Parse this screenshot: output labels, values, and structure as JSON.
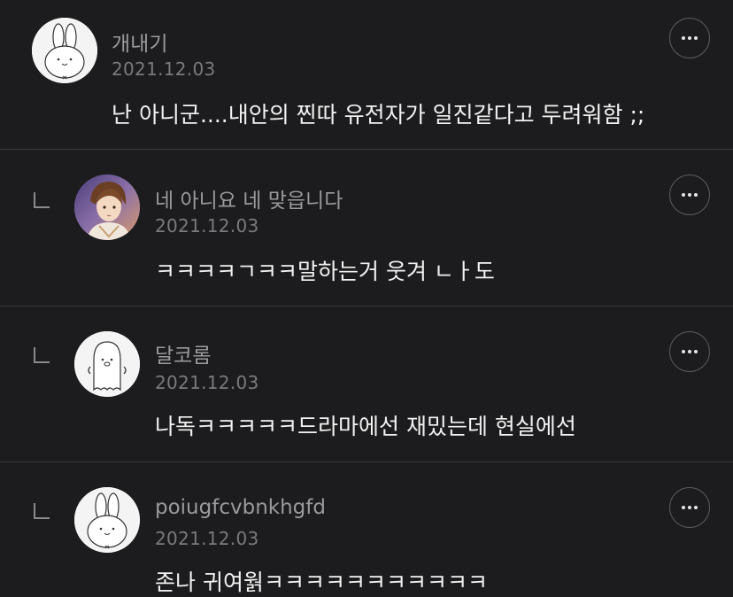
{
  "comments": [
    {
      "username": "개내기",
      "date": "2021.12.03",
      "text": "난 아니군....내안의 찐따 유전자가 일진같다고 두려워함 ;;",
      "avatar_icon": "bunny-avatar-icon",
      "is_reply": false
    },
    {
      "username": "네 아니요 네 맞읍니다",
      "date": "2021.12.03",
      "text": "ㅋㅋㅋㅋㄱㅋㅋ말하는거 웃겨 ㄴㅏ도",
      "avatar_icon": "anime-character-avatar-icon",
      "is_reply": true
    },
    {
      "username": "달코롬",
      "date": "2021.12.03",
      "text": "나독ㅋㅋㅋㅋㅋ드라마에선 재밌는데 현실에선",
      "avatar_icon": "ghost-avatar-icon",
      "is_reply": true
    },
    {
      "username": "poiugfcvbnkhgfd",
      "date": "2021.12.03",
      "text": "존나 귀여웕ㅋㅋㅋㅋㅋㅋㅋㅋㅋㅋㅋ",
      "avatar_icon": "bunny-avatar-icon",
      "is_reply": true
    }
  ],
  "colors": {
    "background": "#1c1c1e",
    "username": "#9a9a9e",
    "date": "#7a7a7e",
    "text": "#f2f2f2",
    "divider": "#3a3a3c"
  },
  "icons": {
    "reply": "reply-arrow-icon",
    "more": "more-options-icon"
  }
}
